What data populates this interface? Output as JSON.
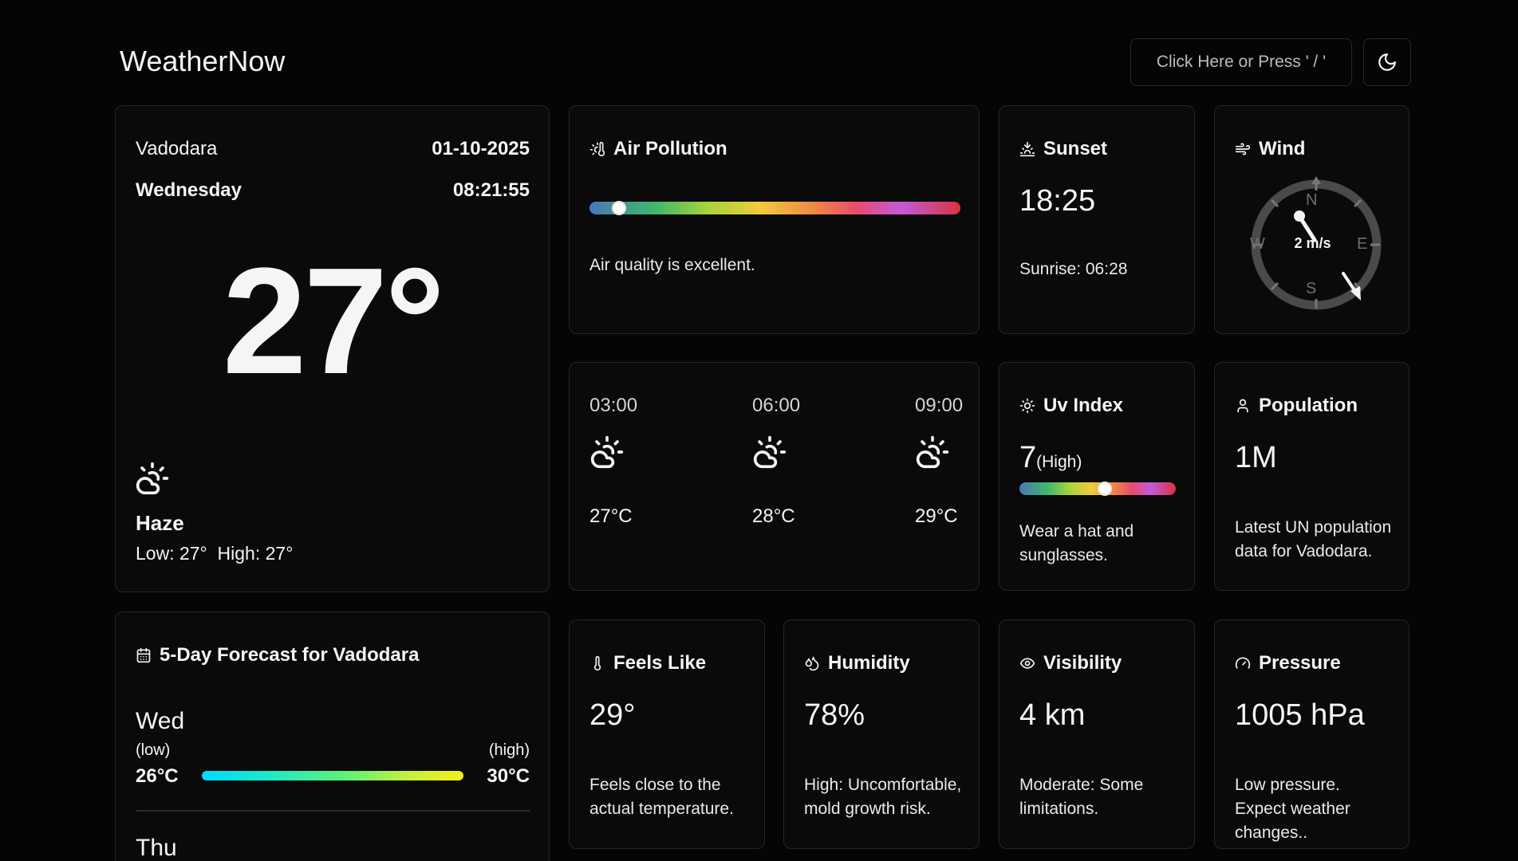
{
  "app": {
    "title": "WeatherNow"
  },
  "search": {
    "label": "Click Here or Press ' / '"
  },
  "theme_toggle": {
    "icon": "moon-icon"
  },
  "current": {
    "city": "Vadodara",
    "date": "01-10-2025",
    "day": "Wednesday",
    "time": "08:21:55",
    "temp": "27°",
    "condition": "Haze",
    "low": "Low: 27°",
    "high": "High: 27°",
    "icon": "partly-cloudy-sun-icon"
  },
  "air_pollution": {
    "title": "Air Pollution",
    "description": "Air quality is excellent.",
    "level_fraction": 0.08
  },
  "sunset": {
    "title": "Sunset",
    "time": "18:25",
    "sunrise": "Sunrise: 06:28"
  },
  "wind": {
    "title": "Wind",
    "speed": "2 m/s",
    "directions": {
      "n": "N",
      "e": "E",
      "s": "S",
      "w": "W"
    },
    "direction_deg": 330
  },
  "hourly": [
    {
      "time": "03:00",
      "temp": "27°C",
      "icon": "partly-cloudy-sun-icon"
    },
    {
      "time": "06:00",
      "temp": "28°C",
      "icon": "partly-cloudy-sun-icon"
    },
    {
      "time": "09:00",
      "temp": "29°C",
      "icon": "partly-cloudy-sun-icon"
    }
  ],
  "uv": {
    "title": "Uv Index",
    "value": "7",
    "level": "(High)",
    "description": "Wear a hat and sunglasses.",
    "level_fraction": 0.55
  },
  "population": {
    "title": "Population",
    "value": "1M",
    "description": "Latest UN population data for Vadodara."
  },
  "forecast": {
    "title": "5-Day Forecast for Vadodara",
    "days": [
      {
        "day": "Wed",
        "low_label": "(low)",
        "high_label": "(high)",
        "low": "26°C",
        "high": "30°C"
      },
      {
        "day": "Thu"
      }
    ]
  },
  "feels_like": {
    "title": "Feels Like",
    "value": "29°",
    "description": "Feels close to the actual temperature."
  },
  "humidity": {
    "title": "Humidity",
    "value": "78%",
    "description": "High: Uncomfortable, mold growth risk."
  },
  "visibility": {
    "title": "Visibility",
    "value": "4 km",
    "description": "Moderate: Some limitations."
  },
  "pressure": {
    "title": "Pressure",
    "value": "1005 hPa",
    "description": "Low pressure. Expect weather changes.."
  },
  "colors": {
    "background": "#050505",
    "card": "#0a0a0a",
    "border": "#262626",
    "text": "#f5f5f5"
  }
}
